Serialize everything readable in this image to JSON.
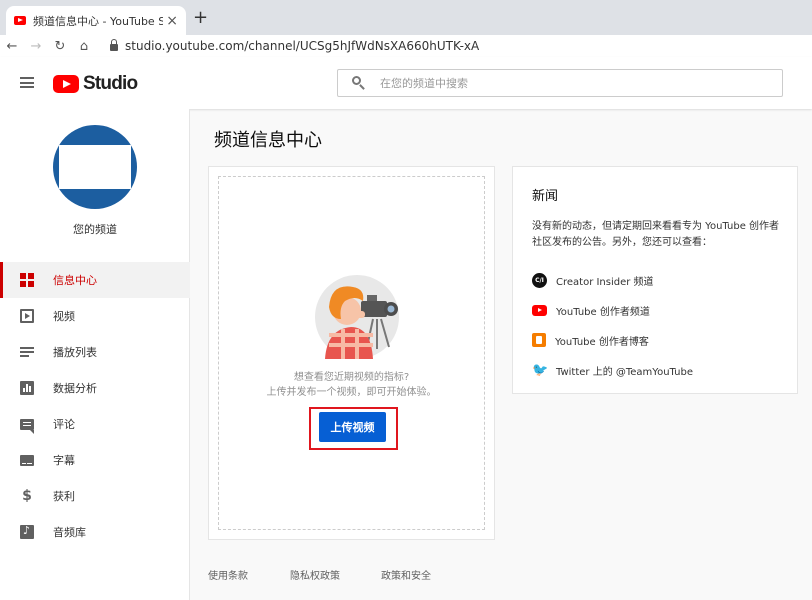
{
  "browser": {
    "tab_title": "频道信息中心 - YouTube Studio",
    "tab_close": "×",
    "new_tab": "+",
    "back": "←",
    "forward": "→",
    "reload": "↻",
    "home": "⌂",
    "url": "studio.youtube.com/channel/UCSg5hJfWdNsXA660hUTK-xA"
  },
  "header": {
    "logo_text": "Studio",
    "search_placeholder": "在您的频道中搜索"
  },
  "sidebar": {
    "channel_name": "您的频道",
    "items": [
      {
        "label": "信息中心",
        "icon": "dashboard-icon",
        "active": true
      },
      {
        "label": "视频",
        "icon": "video-icon"
      },
      {
        "label": "播放列表",
        "icon": "playlist-icon"
      },
      {
        "label": "数据分析",
        "icon": "analytics-icon"
      },
      {
        "label": "评论",
        "icon": "comment-icon"
      },
      {
        "label": "字幕",
        "icon": "subtitles-icon"
      },
      {
        "label": "获利",
        "icon": "dollar-icon"
      },
      {
        "label": "音频库",
        "icon": "audio-library-icon"
      }
    ]
  },
  "main": {
    "page_title": "频道信息中心",
    "upload_card": {
      "hint_line1": "想查看您近期视频的指标?",
      "hint_line2": "上传并发布一个视频，即可开始体验。",
      "upload_button": "上传视频"
    },
    "news": {
      "title": "新闻",
      "body": "没有新的动态，但请定期回来看看专为 YouTube 创作者社区发布的公告。另外，您还可以查看：",
      "links": [
        {
          "label": "Creator Insider 频道",
          "icon": "creator-insider-icon",
          "icon_text": "C/I"
        },
        {
          "label": "YouTube 创作者频道",
          "icon": "youtube-icon"
        },
        {
          "label": "YouTube 创作者博客",
          "icon": "blogger-icon"
        },
        {
          "label": "Twitter 上的 @TeamYouTube",
          "icon": "twitter-icon"
        }
      ]
    }
  },
  "footer": {
    "links": [
      "使用条款",
      "隐私权政策",
      "政策和安全"
    ]
  },
  "colors": {
    "accent_red": "#cc0000",
    "upload_blue": "#065fd4",
    "avatar_blue": "#1c5ea0",
    "highlight_red": "#e0161e"
  }
}
